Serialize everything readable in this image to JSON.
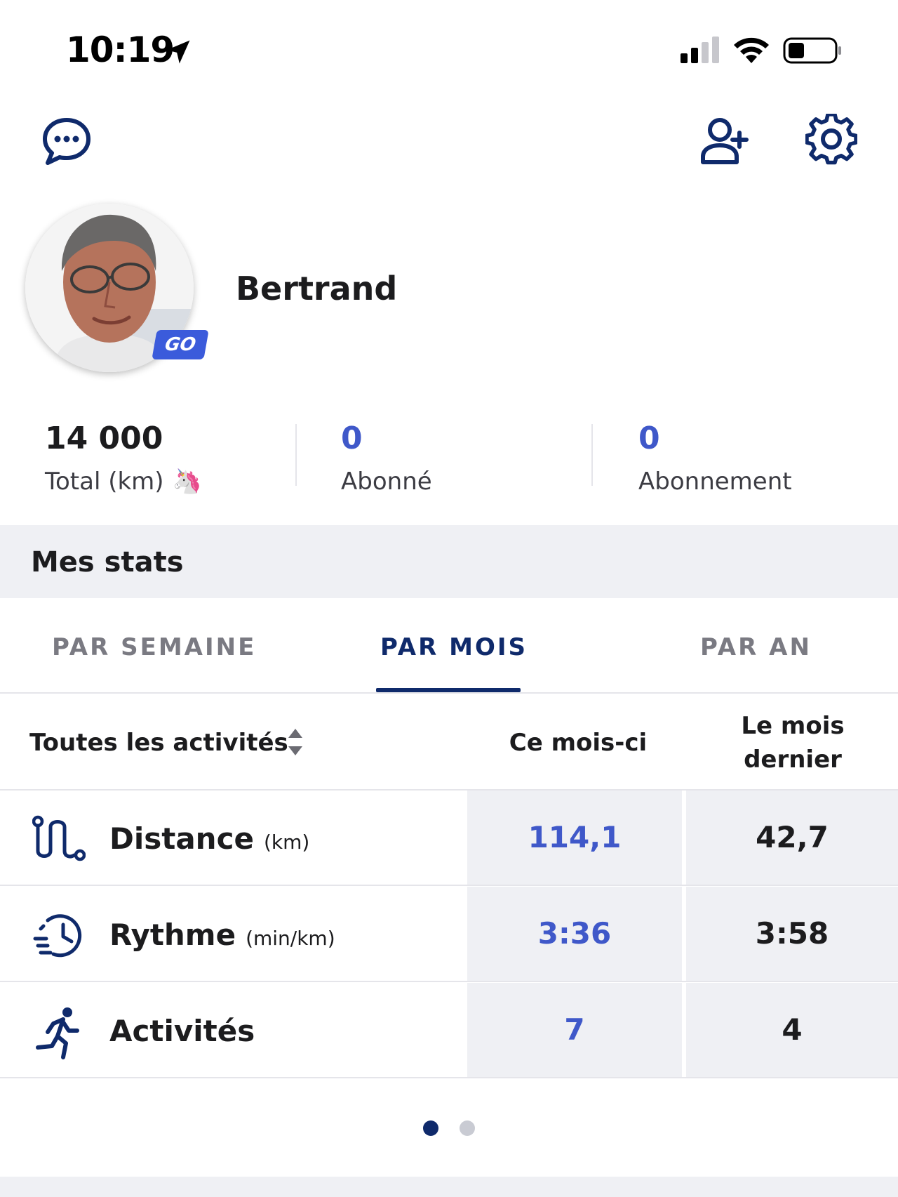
{
  "status_bar": {
    "time": "10:19",
    "icons": [
      "location-arrow-icon",
      "cellular-signal-icon",
      "wifi-icon",
      "battery-icon"
    ]
  },
  "header": {
    "icons": [
      "chat-bubble-icon",
      "add-user-icon",
      "settings-gear-icon"
    ]
  },
  "profile": {
    "name": "Bertrand",
    "badge": "GO"
  },
  "counters": [
    {
      "value": "14 000",
      "label": "Total (km)",
      "emoji": "🦄"
    },
    {
      "value": "0",
      "label": "Abonné"
    },
    {
      "value": "0",
      "label": "Abonnement"
    }
  ],
  "stats": {
    "title": "Mes stats",
    "tabs": [
      {
        "label": "PAR SEMAINE",
        "active": false
      },
      {
        "label": "PAR MOIS",
        "active": true
      },
      {
        "label": "PAR AN",
        "active": false
      }
    ],
    "filter": "Toutes les activités",
    "columns": {
      "this": "Ce mois-ci",
      "last_line1": "Le mois",
      "last_line2": "dernier"
    },
    "rows": [
      {
        "name": "Distance",
        "unit": "(km)",
        "this": "114,1",
        "last": "42,7",
        "icon": "route-icon"
      },
      {
        "name": "Rythme",
        "unit": "(min/km)",
        "this": "3:36",
        "last": "3:58",
        "icon": "pace-clock-icon"
      },
      {
        "name": "Activités",
        "unit": "",
        "this": "7",
        "last": "4",
        "icon": "runner-icon"
      }
    ]
  },
  "pagination": {
    "current": 1,
    "total": 2
  },
  "colors": {
    "accent_blue": "#3f58c9",
    "navy": "#0f2a6b",
    "panel_gray": "#eff0f4"
  }
}
